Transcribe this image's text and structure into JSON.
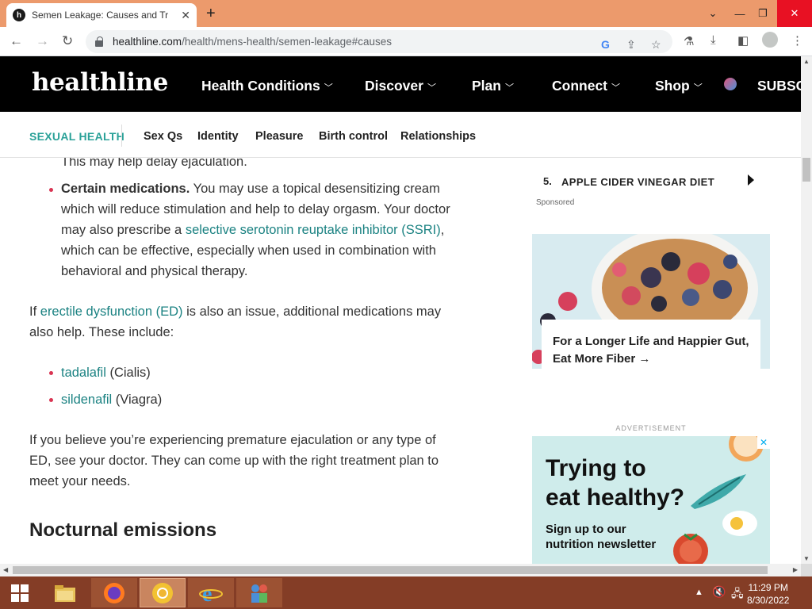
{
  "browser": {
    "tab_title": "Semen Leakage: Causes and Trea",
    "tab_favicon": "h",
    "new_tab": "+",
    "url_domain": "healthline.com",
    "url_path": "/health/mens-health/semen-leakage#causes"
  },
  "site": {
    "logo": "healthline",
    "nav": [
      "Health Conditions",
      "Discover",
      "Plan",
      "Connect",
      "Shop"
    ],
    "subscribe": "SUBSC",
    "subnav_brand": "SEXUAL HEALTH",
    "subnav": [
      "Sex Qs",
      "Identity",
      "Pleasure",
      "Birth control",
      "Relationships"
    ]
  },
  "article": {
    "line0": "This may help delay ejaculation.",
    "med_bold": "Certain medications.",
    "med_text1": " You may use a topical desensitizing cream",
    "med_text2": "which will reduce stimulation and help to delay orgasm. Your doctor",
    "med_text3_pre": "may also prescribe a ",
    "med_link": "selective serotonin reuptake inhibitor (SSRI)",
    "med_text3_post": ",",
    "med_text4": "which can be effective, especially when used in combination with",
    "med_text5": "behavioral and physical therapy.",
    "ed_pre": "If ",
    "ed_link": "erectile dysfunction (ED)",
    "ed_post": " is also an issue, additional medications may",
    "ed_line2": "also help. These include:",
    "drug1_link": "tadalafil",
    "drug1_brand": " (Cialis)",
    "drug2_link": "sildenafil",
    "drug2_brand": " (Viagra)",
    "p3_line1": "If you believe you’re experiencing premature ejaculation or any type of",
    "p3_line2": "ED, see your doctor. They can come up with the right treatment plan to",
    "p3_line3": "meet your needs.",
    "heading": "Nocturnal emissions"
  },
  "sidebar": {
    "list_num": "5.",
    "list_text": "APPLE CIDER VINEGAR DIET",
    "sponsored": "Sponsored",
    "promo_line1": "For a Longer Life and Happier Gut,",
    "promo_line2": "Eat More Fiber",
    "promo_arrow": "→",
    "ad_label": "ADVERTISEMENT",
    "ad_title1": "Trying to",
    "ad_title2": "eat healthy?",
    "ad_sub1": "Sign up to our",
    "ad_sub2": "nutrition newsletter",
    "ad_close": "✕"
  },
  "taskbar": {
    "time": "11:29 PM",
    "date": "8/30/2022"
  },
  "colors": {
    "tabbar": "#ec9a6c",
    "header": "#000000",
    "link": "#1b8282",
    "brand": "#2aa198",
    "bullet": "#d93452",
    "taskbar": "#843d26"
  }
}
